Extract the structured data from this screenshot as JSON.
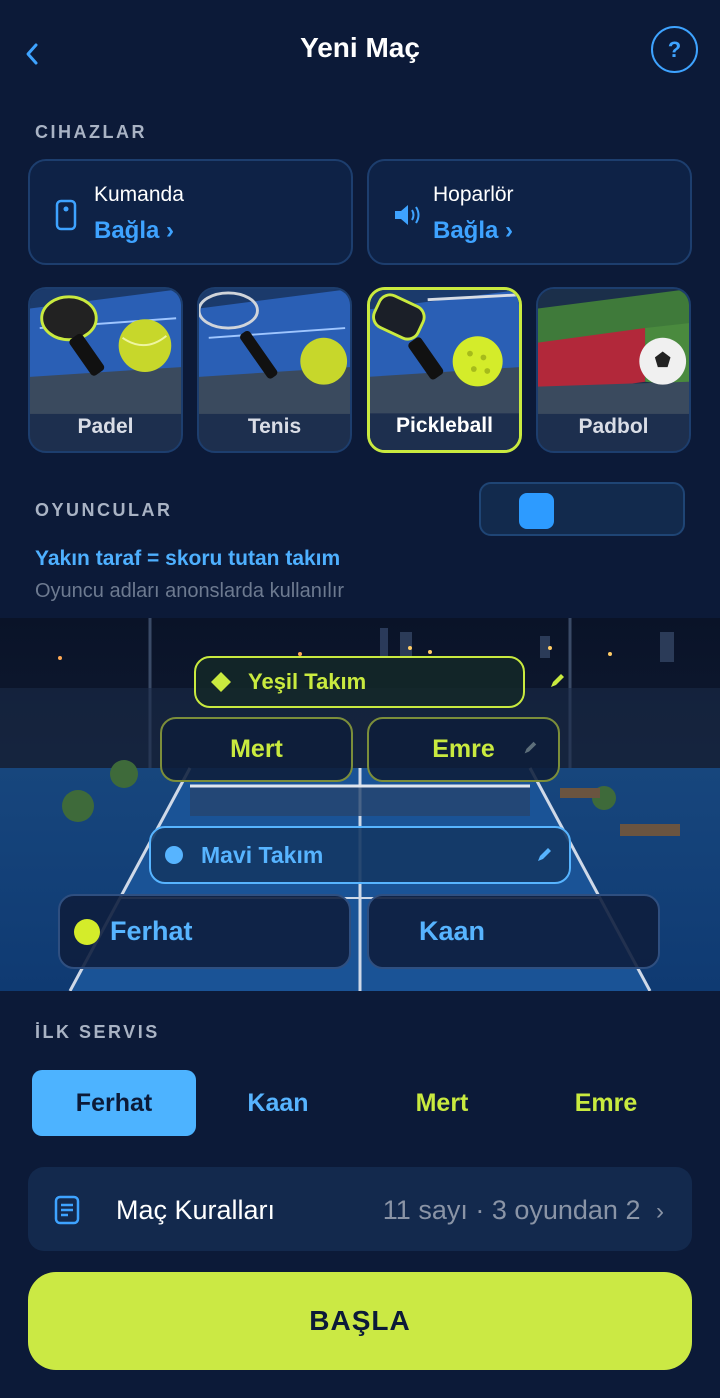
{
  "header": {
    "title": "Yeni Maç",
    "help_label": "?"
  },
  "devices": {
    "section_label": "CIHAZLAR",
    "remote": {
      "title": "Kumanda",
      "action": "Bağla ›",
      "icon": "remote-icon"
    },
    "speaker": {
      "title": "Hoparlör",
      "action": "Bağla ›",
      "icon": "speaker-icon"
    }
  },
  "sports": [
    {
      "label": "Padel",
      "selected": false
    },
    {
      "label": "Tenis",
      "selected": false
    },
    {
      "label": "Pickleball",
      "selected": true
    },
    {
      "label": "Padbol",
      "selected": false
    }
  ],
  "players": {
    "section_label": "OYUNCULAR",
    "hint_strong": "Yakın taraf = skoru tutan takım",
    "hint_sub": "Oyuncu adları anonslarda kullanılır",
    "green_team": {
      "name": "Yeşil Takım",
      "players": [
        "Mert",
        "Emre"
      ],
      "color": "#c9ea3f"
    },
    "blue_team": {
      "name": "Mavi Takım",
      "players": [
        "Ferhat",
        "Kaan"
      ],
      "color": "#57b4ff"
    }
  },
  "first_serve": {
    "section_label": "İLK SERVIS",
    "options": [
      "Ferhat",
      "Kaan",
      "Mert",
      "Emre"
    ],
    "selected": "Ferhat"
  },
  "rules": {
    "label": "Maç Kuralları",
    "value": "11 sayı · 3 oyundan 2",
    "chevron": "›"
  },
  "start_button": {
    "label": "BAŞLA"
  },
  "colors": {
    "background": "#0c1a38",
    "accent_blue": "#3ea3ff",
    "accent_green": "#c9ea3f"
  }
}
